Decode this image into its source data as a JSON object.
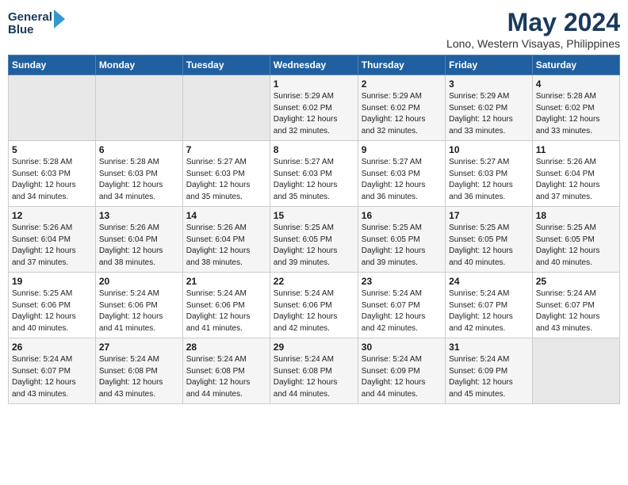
{
  "logo": {
    "line1": "General",
    "line2": "Blue"
  },
  "title": "May 2024",
  "subtitle": "Lono, Western Visayas, Philippines",
  "weekdays": [
    "Sunday",
    "Monday",
    "Tuesday",
    "Wednesday",
    "Thursday",
    "Friday",
    "Saturday"
  ],
  "weeks": [
    [
      {
        "day": null,
        "info": null
      },
      {
        "day": null,
        "info": null
      },
      {
        "day": null,
        "info": null
      },
      {
        "day": "1",
        "info": "Sunrise: 5:29 AM\nSunset: 6:02 PM\nDaylight: 12 hours\nand 32 minutes."
      },
      {
        "day": "2",
        "info": "Sunrise: 5:29 AM\nSunset: 6:02 PM\nDaylight: 12 hours\nand 32 minutes."
      },
      {
        "day": "3",
        "info": "Sunrise: 5:29 AM\nSunset: 6:02 PM\nDaylight: 12 hours\nand 33 minutes."
      },
      {
        "day": "4",
        "info": "Sunrise: 5:28 AM\nSunset: 6:02 PM\nDaylight: 12 hours\nand 33 minutes."
      }
    ],
    [
      {
        "day": "5",
        "info": "Sunrise: 5:28 AM\nSunset: 6:03 PM\nDaylight: 12 hours\nand 34 minutes."
      },
      {
        "day": "6",
        "info": "Sunrise: 5:28 AM\nSunset: 6:03 PM\nDaylight: 12 hours\nand 34 minutes."
      },
      {
        "day": "7",
        "info": "Sunrise: 5:27 AM\nSunset: 6:03 PM\nDaylight: 12 hours\nand 35 minutes."
      },
      {
        "day": "8",
        "info": "Sunrise: 5:27 AM\nSunset: 6:03 PM\nDaylight: 12 hours\nand 35 minutes."
      },
      {
        "day": "9",
        "info": "Sunrise: 5:27 AM\nSunset: 6:03 PM\nDaylight: 12 hours\nand 36 minutes."
      },
      {
        "day": "10",
        "info": "Sunrise: 5:27 AM\nSunset: 6:03 PM\nDaylight: 12 hours\nand 36 minutes."
      },
      {
        "day": "11",
        "info": "Sunrise: 5:26 AM\nSunset: 6:04 PM\nDaylight: 12 hours\nand 37 minutes."
      }
    ],
    [
      {
        "day": "12",
        "info": "Sunrise: 5:26 AM\nSunset: 6:04 PM\nDaylight: 12 hours\nand 37 minutes."
      },
      {
        "day": "13",
        "info": "Sunrise: 5:26 AM\nSunset: 6:04 PM\nDaylight: 12 hours\nand 38 minutes."
      },
      {
        "day": "14",
        "info": "Sunrise: 5:26 AM\nSunset: 6:04 PM\nDaylight: 12 hours\nand 38 minutes."
      },
      {
        "day": "15",
        "info": "Sunrise: 5:25 AM\nSunset: 6:05 PM\nDaylight: 12 hours\nand 39 minutes."
      },
      {
        "day": "16",
        "info": "Sunrise: 5:25 AM\nSunset: 6:05 PM\nDaylight: 12 hours\nand 39 minutes."
      },
      {
        "day": "17",
        "info": "Sunrise: 5:25 AM\nSunset: 6:05 PM\nDaylight: 12 hours\nand 40 minutes."
      },
      {
        "day": "18",
        "info": "Sunrise: 5:25 AM\nSunset: 6:05 PM\nDaylight: 12 hours\nand 40 minutes."
      }
    ],
    [
      {
        "day": "19",
        "info": "Sunrise: 5:25 AM\nSunset: 6:06 PM\nDaylight: 12 hours\nand 40 minutes."
      },
      {
        "day": "20",
        "info": "Sunrise: 5:24 AM\nSunset: 6:06 PM\nDaylight: 12 hours\nand 41 minutes."
      },
      {
        "day": "21",
        "info": "Sunrise: 5:24 AM\nSunset: 6:06 PM\nDaylight: 12 hours\nand 41 minutes."
      },
      {
        "day": "22",
        "info": "Sunrise: 5:24 AM\nSunset: 6:06 PM\nDaylight: 12 hours\nand 42 minutes."
      },
      {
        "day": "23",
        "info": "Sunrise: 5:24 AM\nSunset: 6:07 PM\nDaylight: 12 hours\nand 42 minutes."
      },
      {
        "day": "24",
        "info": "Sunrise: 5:24 AM\nSunset: 6:07 PM\nDaylight: 12 hours\nand 42 minutes."
      },
      {
        "day": "25",
        "info": "Sunrise: 5:24 AM\nSunset: 6:07 PM\nDaylight: 12 hours\nand 43 minutes."
      }
    ],
    [
      {
        "day": "26",
        "info": "Sunrise: 5:24 AM\nSunset: 6:07 PM\nDaylight: 12 hours\nand 43 minutes."
      },
      {
        "day": "27",
        "info": "Sunrise: 5:24 AM\nSunset: 6:08 PM\nDaylight: 12 hours\nand 43 minutes."
      },
      {
        "day": "28",
        "info": "Sunrise: 5:24 AM\nSunset: 6:08 PM\nDaylight: 12 hours\nand 44 minutes."
      },
      {
        "day": "29",
        "info": "Sunrise: 5:24 AM\nSunset: 6:08 PM\nDaylight: 12 hours\nand 44 minutes."
      },
      {
        "day": "30",
        "info": "Sunrise: 5:24 AM\nSunset: 6:09 PM\nDaylight: 12 hours\nand 44 minutes."
      },
      {
        "day": "31",
        "info": "Sunrise: 5:24 AM\nSunset: 6:09 PM\nDaylight: 12 hours\nand 45 minutes."
      },
      {
        "day": null,
        "info": null
      }
    ]
  ]
}
